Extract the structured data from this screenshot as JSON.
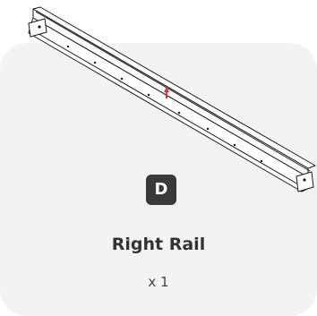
{
  "part": {
    "letter": "D",
    "name": "Right Rail",
    "quantity": "x 1"
  },
  "drawing": {
    "icon": "rail-illustration",
    "marker_color": "#e03030",
    "line_color": "#1a1a1a"
  },
  "card": {
    "background": "#f3f3f3"
  }
}
